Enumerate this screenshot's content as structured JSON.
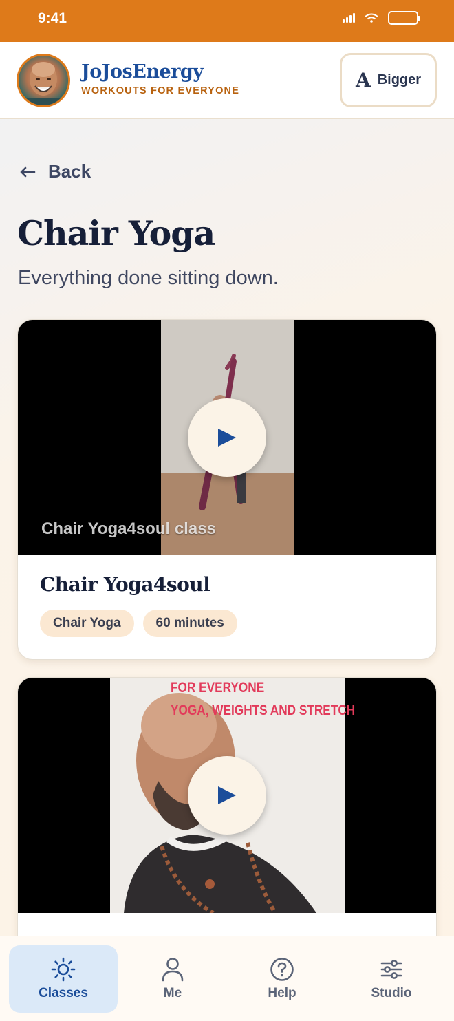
{
  "status_bar": {
    "time": "9:41"
  },
  "header": {
    "brand_name": "JoJosEnergy",
    "tagline": "WORKOUTS FOR EVERYONE",
    "bigger_icon": "A",
    "bigger_label": "Bigger"
  },
  "nav": {
    "back_label": "Back"
  },
  "page": {
    "title": "Chair Yoga",
    "subtitle": "Everything done sitting down."
  },
  "classes": [
    {
      "thumbnail_caption": "Chair Yoga4soul class",
      "title": "Chair Yoga4soul",
      "tags": [
        "Chair Yoga",
        "60 minutes"
      ]
    },
    {
      "thumbnail_caption": [
        "FOR EVERYONE",
        "YOGA, WEIGHTS AND STRETCH"
      ]
    }
  ],
  "tab_bar": {
    "tabs": [
      {
        "label": "Classes",
        "icon": "sun-icon",
        "active": true
      },
      {
        "label": "Me",
        "icon": "person-icon",
        "active": false
      },
      {
        "label": "Help",
        "icon": "help-circle-icon",
        "active": false
      },
      {
        "label": "Studio",
        "icon": "sliders-icon",
        "active": false
      }
    ]
  },
  "colors": {
    "status_bar": "#de7a1a",
    "brand_blue": "#1b4d9a",
    "tagline_orange": "#b8620f",
    "tag_bg": "#fbe8d2",
    "active_tab_bg": "#dbe9f8"
  }
}
